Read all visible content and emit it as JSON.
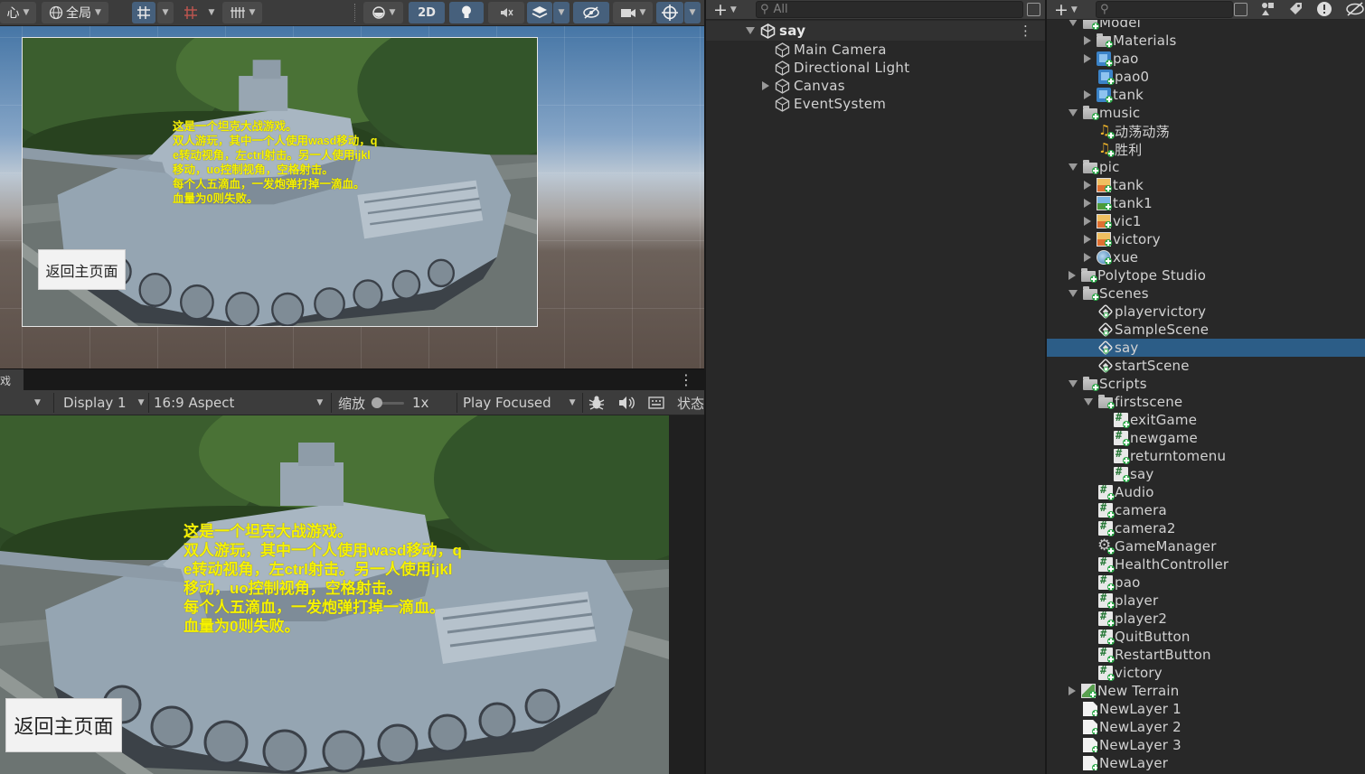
{
  "scene_toolbar": {
    "pivot_label": "心",
    "global_label": "全局",
    "mode_2d_label": "2D"
  },
  "scene_view": {
    "description_lines": [
      "这是一个坦克大战游戏。",
      "双人游玩，其中一个人使用wasd移动，q",
      "e转动视角，左ctrl射击。另一人使用ijkl",
      "移动，uo控制视角，空格射击。",
      "每个人五滴血，一发炮弹打掉一滴血。",
      "血量为0则失败。"
    ],
    "return_button_label": "返回主页面"
  },
  "game_view": {
    "tab_label": "戏",
    "display_label": "Display 1",
    "aspect_label": "16:9 Aspect",
    "scale_label": "缩放",
    "scale_value": "1x",
    "scale_fraction": 0.0,
    "play_mode_label": "Play Focused",
    "stats_label": "状态",
    "description_lines": [
      "这是一个坦克大战游戏。",
      "双人游玩，其中一个人使用wasd移动，q",
      "e转动视角，左ctrl射击。另一人使用ijkl",
      "移动，uo控制视角，空格射击。",
      "每个人五滴血，一发炮弹打掉一滴血。",
      "血量为0则失败。"
    ],
    "return_button_label": "返回主页面"
  },
  "hierarchy": {
    "search_placeholder": "All",
    "scene_name": "say",
    "objects": [
      {
        "label": "Main Camera",
        "expandable": false
      },
      {
        "label": "Directional Light",
        "expandable": false
      },
      {
        "label": "Canvas",
        "expandable": true
      },
      {
        "label": "EventSystem",
        "expandable": false
      }
    ]
  },
  "project": {
    "items": [
      {
        "label": "Model",
        "depth": 0,
        "icon": "folder",
        "arrow": "down"
      },
      {
        "label": "Materials",
        "depth": 1,
        "icon": "folder",
        "arrow": "right"
      },
      {
        "label": "pao",
        "depth": 1,
        "icon": "prefab",
        "arrow": "right"
      },
      {
        "label": "pao0",
        "depth": 1,
        "icon": "prefab",
        "arrow": "none"
      },
      {
        "label": "tank",
        "depth": 1,
        "icon": "prefab",
        "arrow": "right"
      },
      {
        "label": "music",
        "depth": 0,
        "icon": "folder",
        "arrow": "down"
      },
      {
        "label": "动荡动荡",
        "depth": 1,
        "icon": "audio",
        "arrow": "none"
      },
      {
        "label": "胜利",
        "depth": 1,
        "icon": "audio",
        "arrow": "none"
      },
      {
        "label": "pic",
        "depth": 0,
        "icon": "folder",
        "arrow": "down"
      },
      {
        "label": "tank",
        "depth": 1,
        "icon": "image-warm",
        "arrow": "right"
      },
      {
        "label": "tank1",
        "depth": 1,
        "icon": "image",
        "arrow": "right"
      },
      {
        "label": "vic1",
        "depth": 1,
        "icon": "image-warm",
        "arrow": "right"
      },
      {
        "label": "victory",
        "depth": 1,
        "icon": "image-warm",
        "arrow": "right"
      },
      {
        "label": "xue",
        "depth": 1,
        "icon": "image-sky",
        "arrow": "right"
      },
      {
        "label": "Polytope Studio",
        "depth": 0,
        "icon": "folder",
        "arrow": "right"
      },
      {
        "label": "Scenes",
        "depth": 0,
        "icon": "folder",
        "arrow": "down"
      },
      {
        "label": "playervictory",
        "depth": 1,
        "icon": "scene",
        "arrow": "none"
      },
      {
        "label": "SampleScene",
        "depth": 1,
        "icon": "scene",
        "arrow": "none"
      },
      {
        "label": "say",
        "depth": 1,
        "icon": "scene",
        "arrow": "none",
        "selected": true
      },
      {
        "label": "startScene",
        "depth": 1,
        "icon": "scene",
        "arrow": "none"
      },
      {
        "label": "Scripts",
        "depth": 0,
        "icon": "folder",
        "arrow": "down"
      },
      {
        "label": "firstscene",
        "depth": 1,
        "icon": "folder",
        "arrow": "down"
      },
      {
        "label": "exitGame",
        "depth": 2,
        "icon": "script",
        "arrow": "none"
      },
      {
        "label": "newgame",
        "depth": 2,
        "icon": "script",
        "arrow": "none"
      },
      {
        "label": "returntomenu",
        "depth": 2,
        "icon": "script",
        "arrow": "none"
      },
      {
        "label": "say",
        "depth": 2,
        "icon": "script",
        "arrow": "none"
      },
      {
        "label": "Audio",
        "depth": 1,
        "icon": "script",
        "arrow": "none"
      },
      {
        "label": "camera",
        "depth": 1,
        "icon": "script",
        "arrow": "none"
      },
      {
        "label": "camera2",
        "depth": 1,
        "icon": "script",
        "arrow": "none"
      },
      {
        "label": "GameManager",
        "depth": 1,
        "icon": "gear",
        "arrow": "none"
      },
      {
        "label": "HealthController",
        "depth": 1,
        "icon": "script",
        "arrow": "none"
      },
      {
        "label": "pao",
        "depth": 1,
        "icon": "script",
        "arrow": "none"
      },
      {
        "label": "player",
        "depth": 1,
        "icon": "script",
        "arrow": "none"
      },
      {
        "label": "player2",
        "depth": 1,
        "icon": "script",
        "arrow": "none"
      },
      {
        "label": "QuitButton",
        "depth": 1,
        "icon": "script",
        "arrow": "none"
      },
      {
        "label": "RestartButton",
        "depth": 1,
        "icon": "script",
        "arrow": "none"
      },
      {
        "label": "victory",
        "depth": 1,
        "icon": "script",
        "arrow": "none"
      },
      {
        "label": "New Terrain",
        "depth": 0,
        "icon": "terrain",
        "arrow": "right"
      },
      {
        "label": "NewLayer 1",
        "depth": 0,
        "icon": "doc",
        "arrow": "none"
      },
      {
        "label": "NewLayer 2",
        "depth": 0,
        "icon": "doc",
        "arrow": "none"
      },
      {
        "label": "NewLayer 3",
        "depth": 0,
        "icon": "doc",
        "arrow": "none"
      },
      {
        "label": "NewLayer",
        "depth": 0,
        "icon": "doc",
        "arrow": "none"
      }
    ]
  },
  "colors": {
    "text_yellow": "#f6f200",
    "selection_blue": "#2c5d87",
    "panel_dark": "#282828",
    "toolbar_grey": "#3c3c3c"
  }
}
